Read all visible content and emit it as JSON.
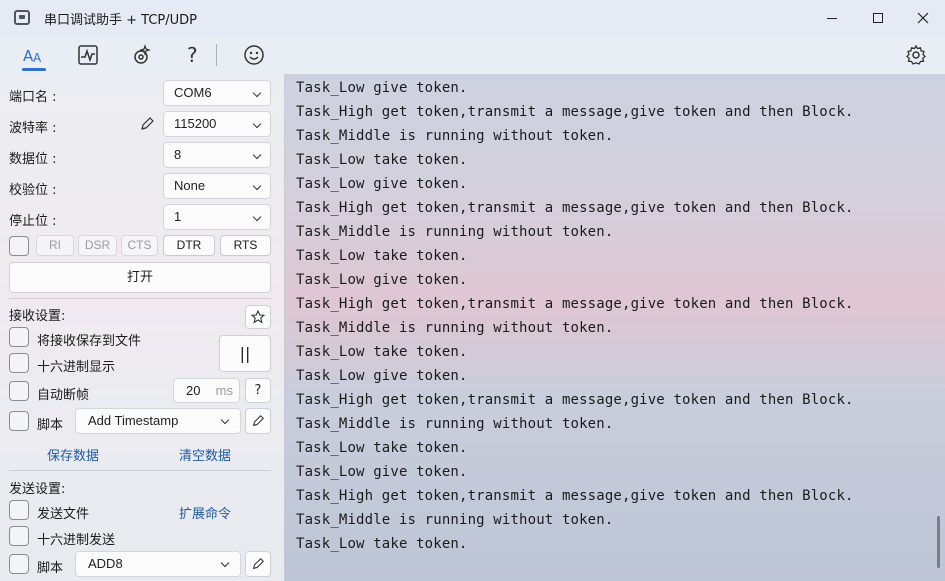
{
  "window": {
    "title": "串口调试助手 + TCP/UDP"
  },
  "toolbar": {
    "icons": [
      "text-format-icon",
      "waveform-chart-icon",
      "gear-sparkle-icon",
      "help-icon",
      "smiley-feedback-icon"
    ],
    "right_icon": "settings-gear-icon",
    "accent": "#2f6fd1"
  },
  "serial": {
    "port_label": "端口名 :",
    "port_value": "COM6",
    "baud_label": "波特率 :",
    "baud_value": "115200",
    "databits_label": "数据位 :",
    "databits_value": "8",
    "parity_label": "校验位 :",
    "parity_value": "None",
    "stopbits_label": "停止位 :",
    "stopbits_value": "1",
    "signals": [
      "RI",
      "DSR",
      "CTS",
      "DTR",
      "RTS"
    ],
    "open_button": "打开"
  },
  "receive": {
    "title": "接收设置:",
    "save_to_file": "将接收保存到文件",
    "hex_display": "十六进制显示",
    "auto_frame": "自动断帧",
    "frame_ms_value": "20",
    "frame_ms_unit": "ms",
    "help": "?",
    "script_label": "脚本",
    "script_value": "Add Timestamp",
    "pause_glyph": "||",
    "save_data": "保存数据",
    "clear_data": "清空数据"
  },
  "send": {
    "title": "发送设置:",
    "send_file": "发送文件",
    "extend_cmd": "扩展命令",
    "hex_send": "十六进制发送",
    "script_label": "脚本",
    "script_value": "ADD8"
  },
  "log": [
    "Task_Low give token.",
    "Task_High get token,transmit a message,give token and then Block.",
    "Task_Middle is running without token.",
    "Task_Low take token.",
    "Task_Low give token.",
    "Task_High get token,transmit a message,give token and then Block.",
    "Task_Middle is running without token.",
    "Task_Low take token.",
    "Task_Low give token.",
    "Task_High get token,transmit a message,give token and then Block.",
    "Task_Middle is running without token.",
    "Task_Low take token.",
    "Task_Low give token.",
    "Task_High get token,transmit a message,give token and then Block.",
    "Task_Middle is running without token.",
    "Task_Low take token.",
    "Task_Low give token.",
    "Task_High get token,transmit a message,give token and then Block.",
    "Task_Middle is running without token.",
    "Task_Low take token."
  ]
}
